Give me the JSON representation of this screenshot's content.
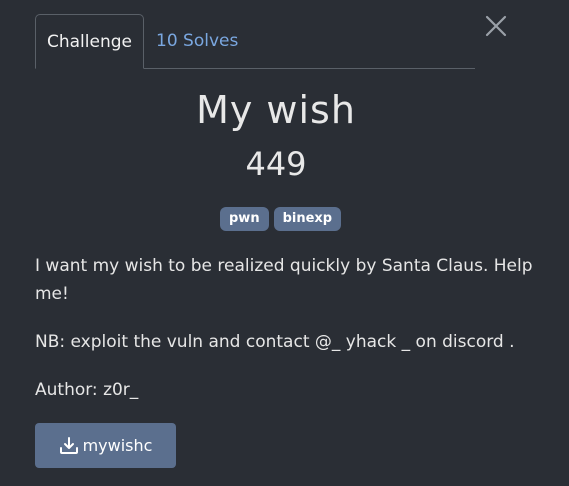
{
  "modal": {
    "tabs": [
      {
        "label": "Challenge",
        "active": true
      },
      {
        "label": "10 Solves",
        "active": false
      }
    ],
    "close_icon": "close-icon"
  },
  "challenge": {
    "title": "My wish",
    "points": "449",
    "tags": [
      "pwn",
      "binexp"
    ],
    "description": [
      "I want my wish to be realized quickly by Santa Claus. Help me!",
      "NB: exploit the vuln and contact @_ yhack _ on discord .",
      "Author: z0r_"
    ],
    "file": {
      "label": "mywishc",
      "icon": "download-icon"
    }
  },
  "colors": {
    "background": "#2a2e35",
    "link": "#7aa7e0",
    "tag_bg": "#5b6f8e",
    "button_bg": "#5b6f8e"
  }
}
